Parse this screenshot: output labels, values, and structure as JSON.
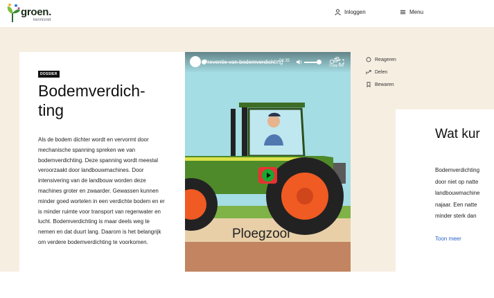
{
  "header": {
    "logo_word": "groen.",
    "logo_sub": "kennisnet",
    "login_label": "Inloggen",
    "menu_label": "Menu"
  },
  "article": {
    "badge": "DOSSIER",
    "title": "Bodemverdich-ting",
    "intro": "Als de bodem dichter wordt en vervormt door mechanische spanning spreken we van bodemverdichting. Deze spanning wordt meestal veroorzaakt door landbouwmachines. Door intensivering van de landbouw worden deze machines groter en zwaarder. Gewassen kunnen minder goed wortelen in een verdichte bodem en er is minder ruimte voor transport van regenwater en lucht. Bodemverdichting is maar deels weg te nemen en dat duurt lang. Daarom is het belangrijk om verdere bodemverdichting te voorkomen."
  },
  "video": {
    "title": "Preventie van bodemverdichting",
    "copy_link": "Copy link",
    "overlay_text": "Ploegzool",
    "time": "-04:35",
    "progress": 0.03,
    "volume": 0.85
  },
  "actions": [
    {
      "icon": "comment-icon",
      "label": "Reageren"
    },
    {
      "icon": "share-icon",
      "label": "Delen"
    },
    {
      "icon": "bookmark-icon",
      "label": "Bewaren"
    }
  ],
  "aside": {
    "title": "Wat kur",
    "lines": [
      "Bodemverdichting",
      "door niet op natte",
      "landbouwmachine",
      "najaar. Een natte",
      "minder sterk dan"
    ],
    "more_label": "Toon meer"
  },
  "colors": {
    "background": "#f7eee2",
    "tractor_green": "#4f8a2a",
    "wheel_orange": "#f05a23",
    "play_red": "#e63232",
    "play_green": "#17a830",
    "link_blue": "#2a62c8"
  }
}
